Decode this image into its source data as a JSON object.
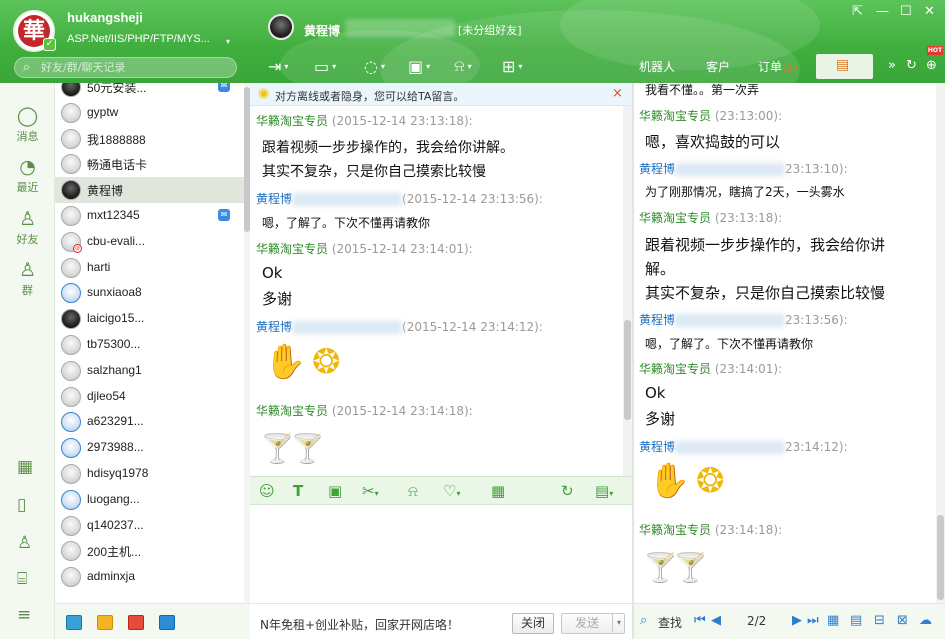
{
  "header": {
    "logo_char": "華",
    "user_name": "hukangsheji",
    "user_signature": "ASP.Net/IIS/PHP/FTP/MYS...",
    "search_placeholder": "好友/群/聊天记录",
    "chat_contact_name": "黄程博",
    "chat_group": "[未分组好友]",
    "right_tabs": [
      {
        "label": "机器人"
      },
      {
        "label": "客户"
      },
      {
        "label": "订单",
        "badge": "(2)"
      }
    ],
    "hot_badge": "HOT"
  },
  "left_nav": [
    {
      "icon": "message-icon",
      "label": "消息"
    },
    {
      "icon": "recent-icon",
      "label": "最近"
    },
    {
      "icon": "friend-icon",
      "label": "好友"
    },
    {
      "icon": "group-icon",
      "label": "群"
    }
  ],
  "contacts": [
    {
      "name": "50元安装...",
      "avatar": "dark",
      "badge": true
    },
    {
      "name": "gyptw"
    },
    {
      "name": "我1888888"
    },
    {
      "name": "畅通电话卡"
    },
    {
      "name": "黄程博",
      "avatar": "dark",
      "selected": true
    },
    {
      "name": "mxt12345",
      "badge": true
    },
    {
      "name": "cbu-evali...",
      "blocked": true
    },
    {
      "name": "harti"
    },
    {
      "name": "sunxiaoa8",
      "avatar": "blue"
    },
    {
      "name": "laicigo15...",
      "avatar": "dark"
    },
    {
      "name": "tb75300..."
    },
    {
      "name": "salzhang1"
    },
    {
      "name": "djleo54"
    },
    {
      "name": "a623291...",
      "avatar": "blue"
    },
    {
      "name": "2973988...",
      "avatar": "blue"
    },
    {
      "name": "hdisyq1978"
    },
    {
      "name": "luogang...",
      "avatar": "blue"
    },
    {
      "name": "q140237..."
    },
    {
      "name": "200主机..."
    },
    {
      "name": "adminxja"
    }
  ],
  "notice": {
    "text": "对方离线或者隐身，您可以给TA留言。",
    "close": "×"
  },
  "chat": {
    "messages": [
      {
        "lines": [
          "跟着视频一步步操作的，我会给你讲解。",
          "其实不复杂，只是你自己摸索比较慢"
        ]
      },
      {
        "sender": "黄程博",
        "time": "(2015-12-14 23:13:56):",
        "lines": [
          "嗯，了解了。下次不懂再请教你"
        ]
      },
      {
        "sender": "华籁淘宝专员",
        "time": "(2015-12-14 23:14:01):",
        "lines": [
          "Ok",
          "多谢"
        ]
      },
      {
        "sender": "黄程博",
        "time": "(2015-12-14 23:14:12):"
      },
      {
        "sender": "华籁淘宝专员",
        "time": "(2015-12-14 23:14:18):"
      }
    ],
    "top_header": {
      "sender": "华籁淘宝专员",
      "time": "(2015-12-14 23:13:18):"
    }
  },
  "input_area": {
    "ad_text": "N年免租+创业补贴，回家开网店咯！",
    "close_label": "关闭",
    "send_label": "发送"
  },
  "history": {
    "top_line": "我看不懂。。第一次弄",
    "entries": [
      {
        "sender": "华籁淘宝专员",
        "time": "(23:13:00):",
        "lines": [
          "嗯，喜欢捣鼓的可以"
        ]
      },
      {
        "sender": "黄程博",
        "time": "23:13:10):",
        "lines": [
          "为了刚那情况，瞎搞了2天，一头雾水"
        ]
      },
      {
        "sender": "华籁淘宝专员",
        "time": "(23:13:18):",
        "lines": [
          "跟着视频一步步操作的，我会给你讲",
          "解。",
          "其实不复杂，只是你自己摸索比较慢"
        ]
      },
      {
        "sender": "黄程博",
        "time": "23:13:56):",
        "lines": [
          "嗯，了解了。下次不懂再请教你"
        ]
      },
      {
        "sender": "华籁淘宝专员",
        "time": "(23:14:01):",
        "lines": [
          "Ok",
          "多谢"
        ]
      },
      {
        "sender": "黄程博",
        "time": "23:14:12):"
      },
      {
        "sender": "华籁淘宝专员",
        "time": "(23:14:18):"
      }
    ],
    "footer": {
      "search_label": "查找",
      "page": "2/2"
    }
  }
}
